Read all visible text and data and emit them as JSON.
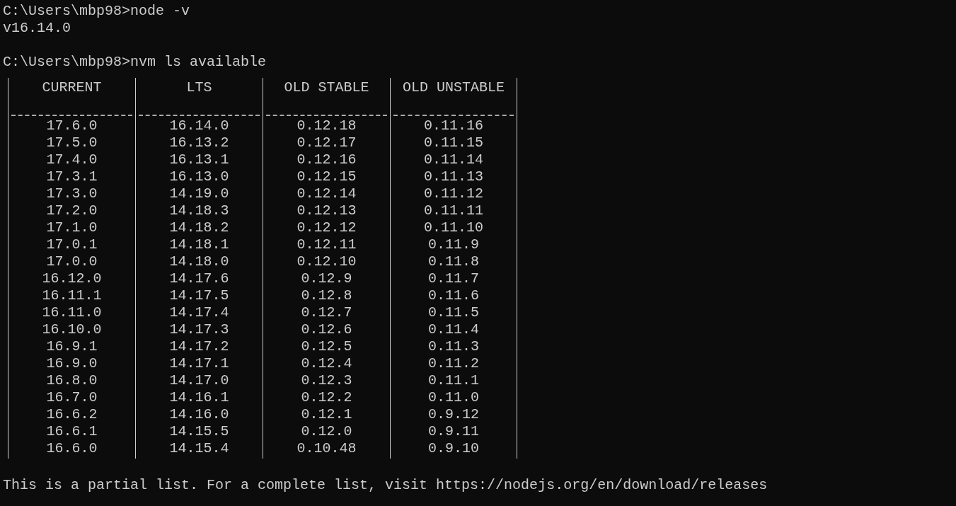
{
  "lines_before": [
    {
      "kind": "command",
      "prompt": "C:\\Users\\mbp98>",
      "command": "node -v"
    },
    {
      "kind": "output",
      "text": "v16.14.0"
    },
    {
      "kind": "blank"
    },
    {
      "kind": "command",
      "prompt": "C:\\Users\\mbp98>",
      "command": "nvm ls available"
    }
  ],
  "table": {
    "columns": [
      "CURRENT",
      "LTS",
      "OLD STABLE",
      "OLD UNSTABLE"
    ],
    "rows": [
      [
        "17.6.0",
        "16.14.0",
        "0.12.18",
        "0.11.16"
      ],
      [
        "17.5.0",
        "16.13.2",
        "0.12.17",
        "0.11.15"
      ],
      [
        "17.4.0",
        "16.13.1",
        "0.12.16",
        "0.11.14"
      ],
      [
        "17.3.1",
        "16.13.0",
        "0.12.15",
        "0.11.13"
      ],
      [
        "17.3.0",
        "14.19.0",
        "0.12.14",
        "0.11.12"
      ],
      [
        "17.2.0",
        "14.18.3",
        "0.12.13",
        "0.11.11"
      ],
      [
        "17.1.0",
        "14.18.2",
        "0.12.12",
        "0.11.10"
      ],
      [
        "17.0.1",
        "14.18.1",
        "0.12.11",
        "0.11.9"
      ],
      [
        "17.0.0",
        "14.18.0",
        "0.12.10",
        "0.11.8"
      ],
      [
        "16.12.0",
        "14.17.6",
        "0.12.9",
        "0.11.7"
      ],
      [
        "16.11.1",
        "14.17.5",
        "0.12.8",
        "0.11.6"
      ],
      [
        "16.11.0",
        "14.17.4",
        "0.12.7",
        "0.11.5"
      ],
      [
        "16.10.0",
        "14.17.3",
        "0.12.6",
        "0.11.4"
      ],
      [
        "16.9.1",
        "14.17.2",
        "0.12.5",
        "0.11.3"
      ],
      [
        "16.9.0",
        "14.17.1",
        "0.12.4",
        "0.11.2"
      ],
      [
        "16.8.0",
        "14.17.0",
        "0.12.3",
        "0.11.1"
      ],
      [
        "16.7.0",
        "14.16.1",
        "0.12.2",
        "0.11.0"
      ],
      [
        "16.6.2",
        "14.16.0",
        "0.12.1",
        "0.9.12"
      ],
      [
        "16.6.1",
        "14.15.5",
        "0.12.0",
        "0.9.11"
      ],
      [
        "16.6.0",
        "14.15.4",
        "0.10.48",
        "0.9.10"
      ]
    ]
  },
  "footer": "This is a partial list. For a complete list, visit https://nodejs.org/en/download/releases"
}
